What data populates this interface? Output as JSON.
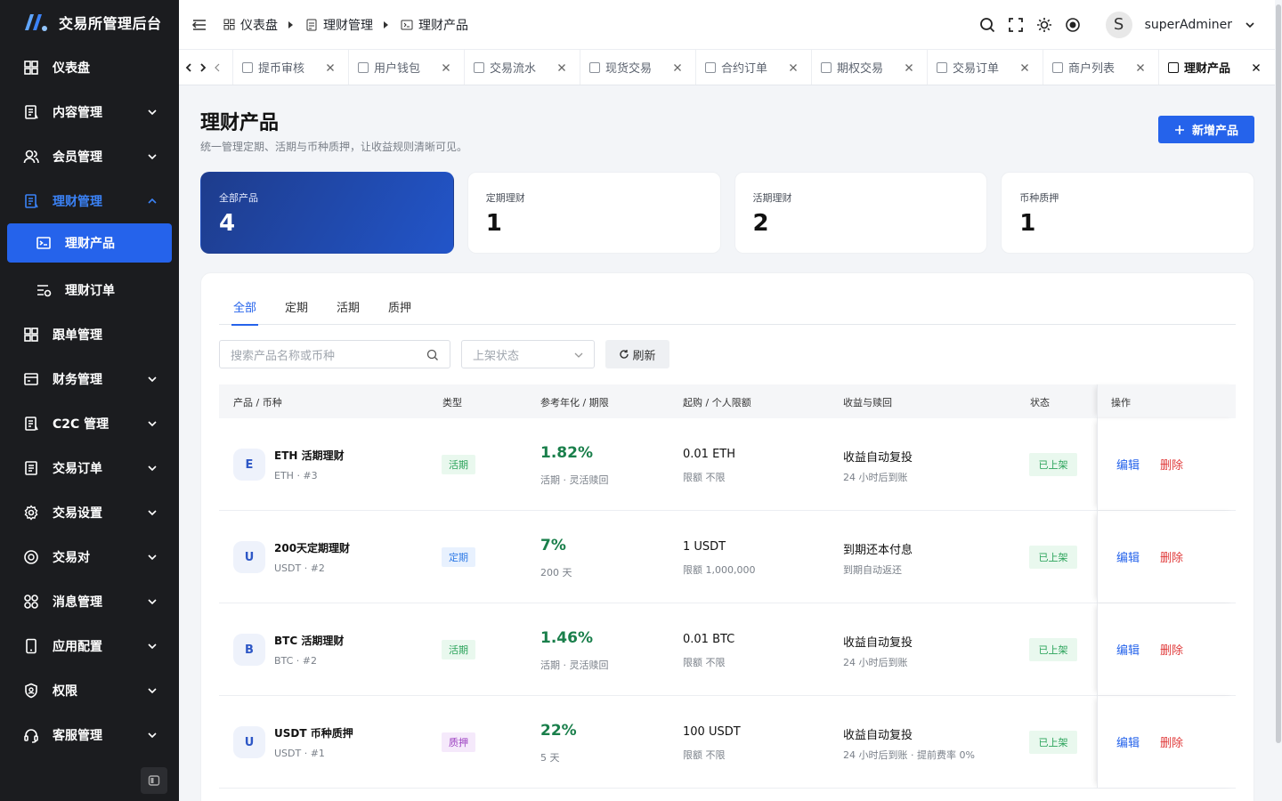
{
  "app": {
    "title": "交易所管理后台",
    "brand_color": "#2563eb"
  },
  "sidebar": {
    "items": [
      {
        "label": "仪表盘",
        "icon": "dashboard-icon",
        "has_children": false
      },
      {
        "label": "内容管理",
        "icon": "document-icon",
        "has_children": true
      },
      {
        "label": "会员管理",
        "icon": "users-icon",
        "has_children": true
      },
      {
        "label": "理财管理",
        "icon": "finance-icon",
        "has_children": true,
        "open": true
      },
      {
        "label": "理财产品",
        "icon": "terminal-icon",
        "active": true
      },
      {
        "label": "理财订单",
        "icon": "list-order-icon"
      },
      {
        "label": "跟单管理",
        "icon": "grid-icon",
        "has_children": false
      },
      {
        "label": "财务管理",
        "icon": "wallet-icon",
        "has_children": true
      },
      {
        "label": "C2C 管理",
        "icon": "document-icon",
        "has_children": true
      },
      {
        "label": "交易订单",
        "icon": "order-icon",
        "has_children": true
      },
      {
        "label": "交易设置",
        "icon": "gear-icon",
        "has_children": true
      },
      {
        "label": "交易对",
        "icon": "coin-icon",
        "has_children": true
      },
      {
        "label": "消息管理",
        "icon": "apps-icon",
        "has_children": true
      },
      {
        "label": "应用配置",
        "icon": "phone-icon",
        "has_children": true
      },
      {
        "label": "权限",
        "icon": "shield-icon",
        "has_children": true
      },
      {
        "label": "客服管理",
        "icon": "headset-icon",
        "has_children": true
      }
    ]
  },
  "header": {
    "breadcrumb": [
      "仪表盘",
      "理财管理",
      "理财产品"
    ],
    "avatar_letter": "S",
    "username": "superAdminer"
  },
  "tabs": [
    {
      "label": "提币审核"
    },
    {
      "label": "用户钱包"
    },
    {
      "label": "交易流水"
    },
    {
      "label": "现货交易"
    },
    {
      "label": "合约订单"
    },
    {
      "label": "期权交易"
    },
    {
      "label": "交易订单"
    },
    {
      "label": "商户列表"
    },
    {
      "label": "理财产品",
      "active": true
    }
  ],
  "page": {
    "title": "理财产品",
    "subtitle": "统一管理定期、活期与币种质押，让收益规则清晰可见。",
    "add_button": "新增产品"
  },
  "stats": [
    {
      "label": "全部产品",
      "value": "4"
    },
    {
      "label": "定期理财",
      "value": "1"
    },
    {
      "label": "活期理财",
      "value": "2"
    },
    {
      "label": "币种质押",
      "value": "1"
    }
  ],
  "filter_tabs": [
    "全部",
    "定期",
    "活期",
    "质押"
  ],
  "filters": {
    "search_placeholder": "搜索产品名称或币种",
    "status_placeholder": "上架状态",
    "refresh_label": "刷新"
  },
  "table": {
    "columns": [
      "产品 / 币种",
      "类型",
      "参考年化 / 期限",
      "起购 / 个人限额",
      "收益与赎回",
      "状态",
      "操作"
    ],
    "rows": [
      {
        "avatar": "E",
        "name": "ETH 活期理财",
        "sub": "ETH · #3",
        "type": "活期",
        "type_style": "green",
        "rate": "1.82%",
        "rate_sub": "活期 · 灵活赎回",
        "min_buy": "0.01 ETH",
        "limit": "限额 不限",
        "income": "收益自动复投",
        "income_sub": "24 小时后到账",
        "status": "已上架",
        "edit": "编辑",
        "delete": "删除"
      },
      {
        "avatar": "U",
        "name": "200天定期理财",
        "sub": "USDT · #2",
        "type": "定期",
        "type_style": "blue",
        "rate": "7%",
        "rate_sub": "200 天",
        "min_buy": "1 USDT",
        "limit": "限额 1,000,000",
        "income": "到期还本付息",
        "income_sub": "到期自动返还",
        "status": "已上架",
        "edit": "编辑",
        "delete": "删除"
      },
      {
        "avatar": "B",
        "name": "BTC 活期理财",
        "sub": "BTC · #2",
        "type": "活期",
        "type_style": "green",
        "rate": "1.46%",
        "rate_sub": "活期 · 灵活赎回",
        "min_buy": "0.01 BTC",
        "limit": "限额 不限",
        "income": "收益自动复投",
        "income_sub": "24 小时后到账",
        "status": "已上架",
        "edit": "编辑",
        "delete": "删除"
      },
      {
        "avatar": "U",
        "name": "USDT 币种质押",
        "sub": "USDT · #1",
        "type": "质押",
        "type_style": "purple",
        "rate": "22%",
        "rate_sub": "5 天",
        "min_buy": "100 USDT",
        "limit": "限额 不限",
        "income": "收益自动复投",
        "income_sub": "24 小时后到账 · 提前费率 0%",
        "status": "已上架",
        "edit": "编辑",
        "delete": "删除"
      }
    ]
  }
}
